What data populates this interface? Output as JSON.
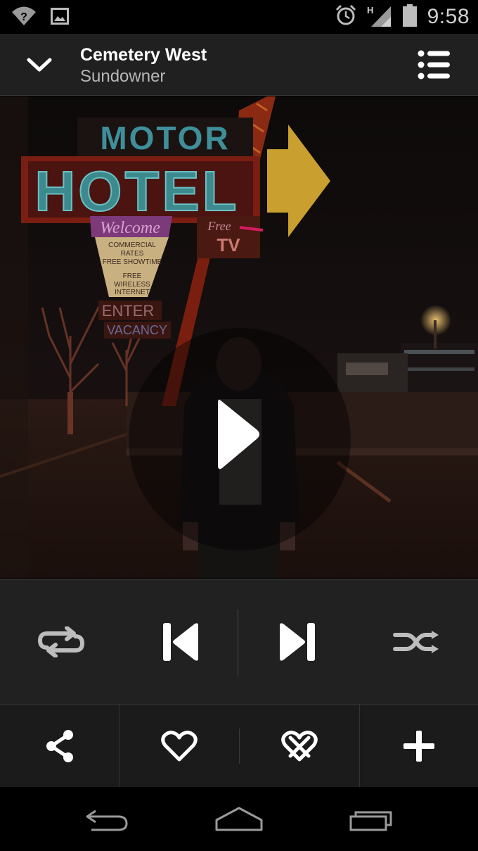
{
  "status_bar": {
    "time": "9:58",
    "network_type": "H",
    "left_icons": [
      "wifi-unknown-icon",
      "image-notification-icon"
    ],
    "right_icons": [
      "alarm-icon",
      "signal-icon",
      "battery-icon"
    ]
  },
  "header": {
    "title": "Cemetery West",
    "subtitle": "Sundowner",
    "collapse_icon": "chevron-down-icon",
    "queue_icon": "queue-list-icon"
  },
  "artwork": {
    "play_icon": "play-icon"
  },
  "controls": {
    "items": [
      "repeat-icon",
      "previous-icon",
      "next-icon",
      "shuffle-icon"
    ]
  },
  "actions": {
    "items": [
      "share-icon",
      "love-icon",
      "ban-icon",
      "add-icon"
    ]
  },
  "navbar": {
    "items": [
      "back-icon",
      "home-icon",
      "recents-icon"
    ]
  },
  "colors": {
    "accent": "#d81b60",
    "header_bg": "#202020",
    "controls_bg": "#212121",
    "actions_bg": "#1b1b1b",
    "icon": "#ffffff",
    "icon_dim": "#bdbdbd"
  }
}
